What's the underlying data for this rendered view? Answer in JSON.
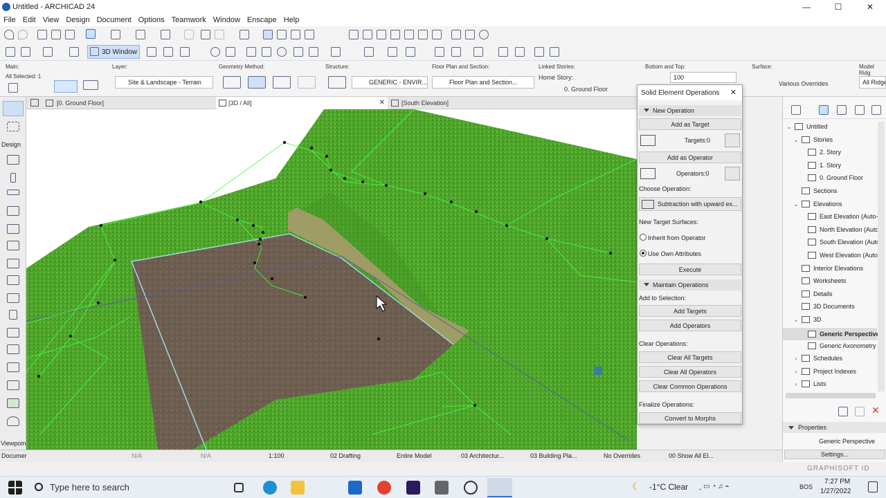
{
  "window": {
    "title": "Untitled - ARCHICAD 24",
    "min": "—",
    "max": "☐",
    "close": "✕"
  },
  "menu": [
    "File",
    "Edit",
    "View",
    "Design",
    "Document",
    "Options",
    "Teamwork",
    "Window",
    "Enscape",
    "Help"
  ],
  "toolbar2": {
    "window_3d_label": "3D Window"
  },
  "infobox": {
    "main_label": "Main:",
    "all_selected": "All Selected: 1",
    "layer_label": "Layer:",
    "layer_value": "Site & Landscape - Terrain",
    "geometry_label": "Geometry Method:",
    "structure_label": "Structure:",
    "structure_value": "GENERIC - ENVIR...",
    "floorplan_label": "Floor Plan and Section:",
    "floorplan_value": "Floor Plan and Section...",
    "linked_label": "Linked Stories:",
    "home_story_label": "Home Story:",
    "home_story_value": "0. Ground Floor",
    "bottomtop_label": "Bottom and Top:",
    "bottomtop_value": "100",
    "surface_label": "Surface:",
    "surface_value": "Various Overrides",
    "model_ridge_label": "Model Ridg",
    "model_ridge_value": "All Ridge"
  },
  "toolbox": {
    "design_label": "Design",
    "viewpoint_label": "Viewpoin",
    "document_label": "Documer"
  },
  "tabs": [
    {
      "label": "[0. Ground Floor]"
    },
    {
      "label": "[3D / All]",
      "close": "✕"
    },
    {
      "label": "[South Elevation]"
    }
  ],
  "panel": {
    "title": "Solid Element Operations",
    "close": "✕",
    "new_operation": "New Operation",
    "add_as_target": "Add as Target",
    "targets": "Targets:0",
    "add_as_operator": "Add as Operator",
    "operators": "Operators:0",
    "choose_operation": "Choose Operation:",
    "operation_value": "Subtraction with upward ex...",
    "new_target_surfaces": "New Target Surfaces:",
    "inherit": "Inherit from Operator",
    "use_own": "Use Own Attributes",
    "execute": "Execute",
    "maintain": "Maintain Operations",
    "add_to_selection": "Add to Selection:",
    "add_targets": "Add Targets",
    "add_operators": "Add Operators",
    "clear_operations": "Clear Operations:",
    "clear_all_targets": "Clear All Targets",
    "clear_all_operators": "Clear All Operators",
    "clear_common": "Clear Common Operations",
    "finalize": "Finalize Operations:",
    "convert": "Convert to Morphs"
  },
  "navigator": {
    "items": [
      {
        "label": "Untitled",
        "ex": "⌄"
      },
      {
        "label": "Stories",
        "ex": "⌄"
      },
      {
        "label": "2. Story",
        "ex": ""
      },
      {
        "label": "1. Story",
        "ex": ""
      },
      {
        "label": "0. Ground Floor",
        "ex": ""
      },
      {
        "label": "Sections",
        "ex": ""
      },
      {
        "label": "Elevations",
        "ex": "⌄"
      },
      {
        "label": "East Elevation (Auto-r",
        "ex": ""
      },
      {
        "label": "North Elevation (Auto",
        "ex": ""
      },
      {
        "label": "South Elevation (Auto",
        "ex": ""
      },
      {
        "label": "West Elevation (Auto-",
        "ex": ""
      },
      {
        "label": "Interior Elevations",
        "ex": ""
      },
      {
        "label": "Worksheets",
        "ex": ""
      },
      {
        "label": "Details",
        "ex": ""
      },
      {
        "label": "3D Documents",
        "ex": ""
      },
      {
        "label": "3D",
        "ex": "⌄"
      },
      {
        "label": "Generic Perspective",
        "ex": ""
      },
      {
        "label": "Generic Axonometry",
        "ex": ""
      },
      {
        "label": "Schedules",
        "ex": "›"
      },
      {
        "label": "Project Indexes",
        "ex": "›"
      },
      {
        "label": "Lists",
        "ex": "›"
      }
    ],
    "properties_label": "Properties",
    "properties_value": "Generic Perspective",
    "settings_label": "Settings...",
    "brand": "GRAPHISOFT ID"
  },
  "status": {
    "na1": "N/A",
    "na2": "N/A",
    "scale": "1:100",
    "layer_combo": "02 Drafting",
    "model": "Entire Model",
    "penset": "03 Architectur...",
    "mvo": "03 Building Pla...",
    "overrides": "No Overrides",
    "dim": "00 Show All El..."
  },
  "taskbar": {
    "search": "Type here to search",
    "weather": "-1°C  Clear",
    "lang": "BOS",
    "time": "7:27 PM",
    "date": "1/27/2022"
  },
  "colors": {
    "accent": "#2f6fd6",
    "terrain": "#4fa52b",
    "pad": "#6b5c4e"
  }
}
